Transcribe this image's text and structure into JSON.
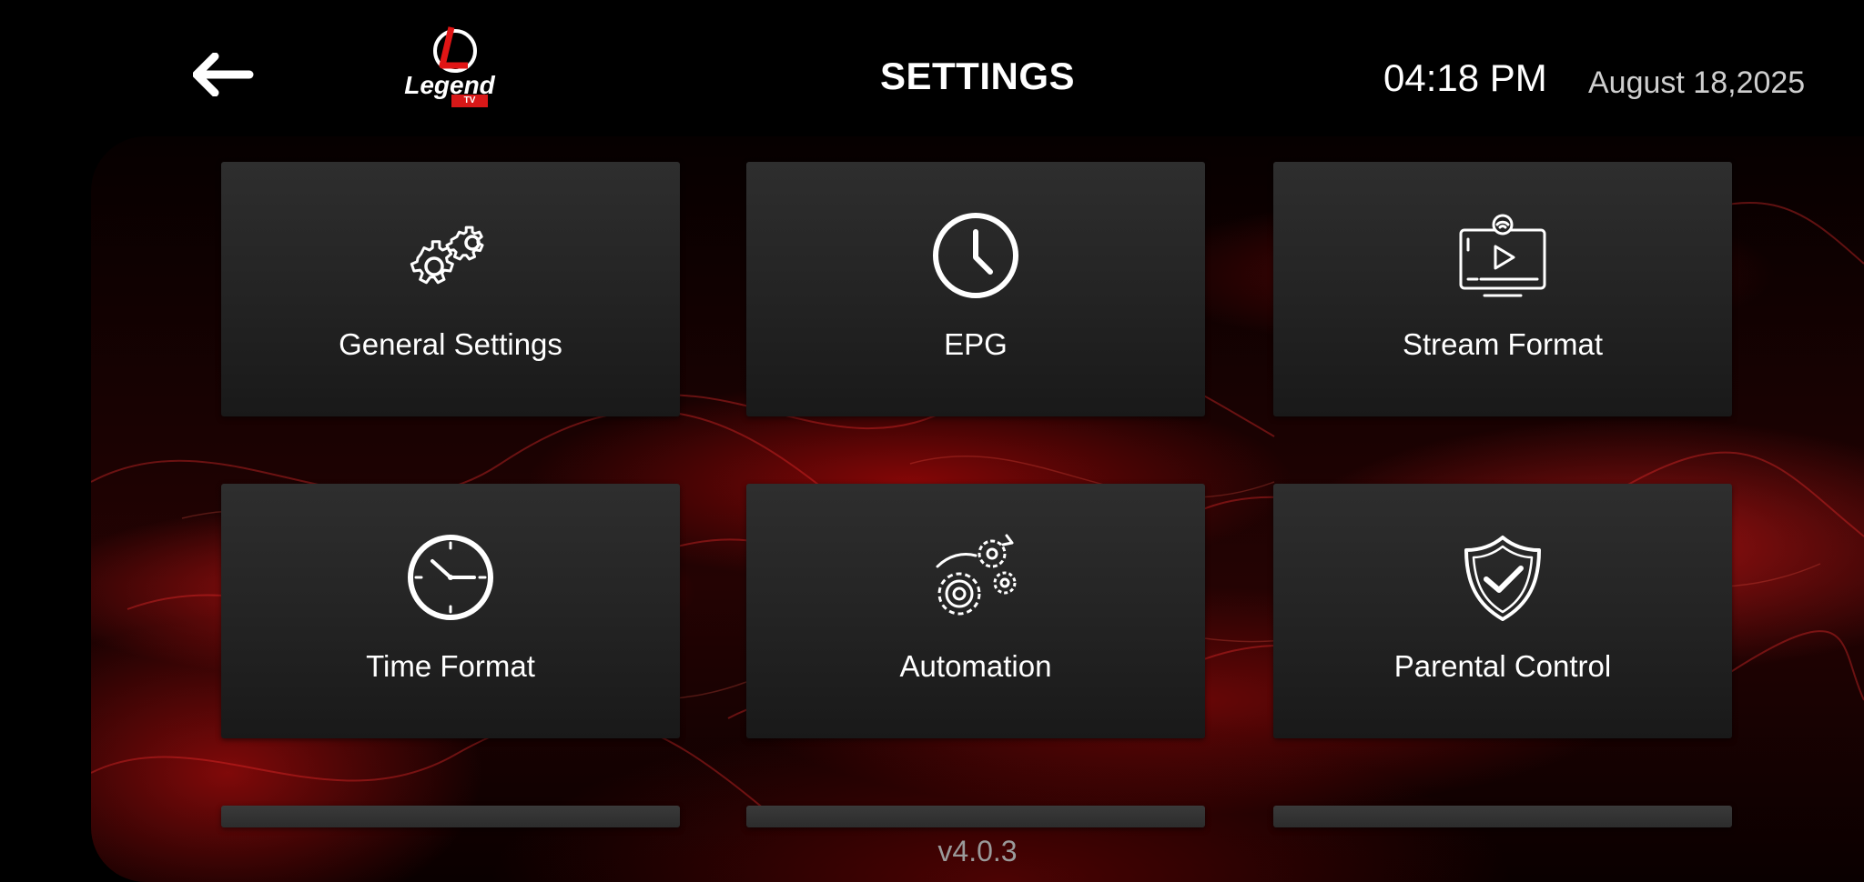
{
  "header": {
    "title": "SETTINGS",
    "time": "04:18 PM",
    "date": "August 18,2025",
    "back_icon": "arrow-left-icon",
    "logo": {
      "main_text": "Legend",
      "badge_text": "TV",
      "letter": "L"
    }
  },
  "tiles": [
    {
      "label": "General Settings",
      "icon": "gears-icon"
    },
    {
      "label": "EPG",
      "icon": "clock-icon"
    },
    {
      "label": "Stream Format",
      "icon": "stream-tv-icon"
    },
    {
      "label": "Time Format",
      "icon": "time-format-clock-icon"
    },
    {
      "label": "Automation",
      "icon": "automation-gears-icon"
    },
    {
      "label": "Parental Control",
      "icon": "shield-check-icon"
    }
  ],
  "footer": {
    "version": "v4.0.3"
  },
  "colors": {
    "background": "#000000",
    "tile": "#262626",
    "accent": "#d81818",
    "text": "#ffffff",
    "muted": "#9a9a9a"
  }
}
